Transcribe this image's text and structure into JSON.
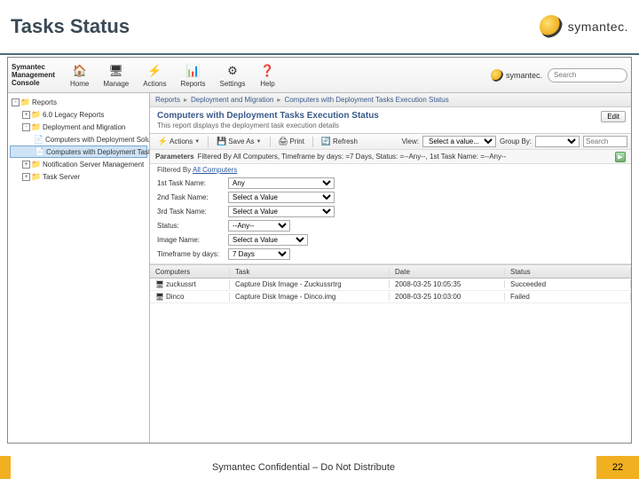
{
  "slide": {
    "title": "Tasks Status",
    "footer": "Symantec Confidential – Do Not Distribute",
    "page": "22"
  },
  "brand": {
    "name": "symantec.",
    "console_label": "Symantec\nManagement\nConsole"
  },
  "topnav": [
    {
      "label": "Home",
      "icon": "🏠"
    },
    {
      "label": "Manage",
      "icon": "🖥"
    },
    {
      "label": "Actions",
      "icon": "⚡"
    },
    {
      "label": "Reports",
      "icon": "📊"
    },
    {
      "label": "Settings",
      "icon": "⚙"
    },
    {
      "label": "Help",
      "icon": "❓"
    }
  ],
  "search": {
    "placeholder": "Search"
  },
  "tree": [
    {
      "toggle": "-",
      "icon": "📁",
      "label": "Reports",
      "indent": 0
    },
    {
      "toggle": "+",
      "icon": "📁",
      "label": "6.0 Legacy Reports",
      "indent": 1
    },
    {
      "toggle": "-",
      "icon": "📁",
      "label": "Deployment and Migration",
      "indent": 1
    },
    {
      "toggle": "",
      "icon": "📄",
      "label": "Computers with Deployment Solution T",
      "indent": 2
    },
    {
      "toggle": "",
      "icon": "📄",
      "label": "Computers with Deployment Tasks Exe",
      "indent": 2,
      "selected": true
    },
    {
      "toggle": "+",
      "icon": "📁",
      "label": "Notification Server Management",
      "indent": 1
    },
    {
      "toggle": "+",
      "icon": "📁",
      "label": "Task Server",
      "indent": 1
    }
  ],
  "breadcrumb": [
    "Reports",
    "Deployment and Migration",
    "Computers with Deployment Tasks Execution Status"
  ],
  "report": {
    "title": "Computers with Deployment Tasks Execution Status",
    "subtitle": "This report displays the deployment task execution details",
    "edit": "Edit"
  },
  "toolbar": {
    "actions": "Actions",
    "saveas": "Save As",
    "print": "Print",
    "refresh": "Refresh",
    "view_label": "View:",
    "view_value": "Select a value...",
    "group_label": "Group By:",
    "search": "Search"
  },
  "parameters": {
    "label": "Parameters",
    "summary": "Filtered By All Computers, Timeframe by days: =7 Days, Status: =--Any--, 1st Task Name: =--Any--",
    "filtered_prefix": "Filtered By",
    "filtered_link": "All Computers",
    "rows": [
      {
        "label": "1st Task Name:",
        "value": "Any"
      },
      {
        "label": "2nd Task Name:",
        "value": "Select a Value"
      },
      {
        "label": "3rd Task Name:",
        "value": "Select a Value"
      },
      {
        "label": "Status:",
        "value": "--Any--"
      },
      {
        "label": "Image Name:",
        "value": "Select a Value"
      },
      {
        "label": "Timeframe by days:",
        "value": "7 Days"
      }
    ]
  },
  "table": {
    "headers": [
      "Computers",
      "Task",
      "Date",
      "Status"
    ],
    "rows": [
      {
        "c": "zuckussrt",
        "t": "Capture Disk Image - Zuckussrtrg",
        "d": "2008-03-25 10:05:35",
        "s": "Succeeded"
      },
      {
        "c": "Dinco",
        "t": "Capture Disk Image - Dinco.img",
        "d": "2008-03-25 10:03:00",
        "s": "Failed"
      }
    ]
  }
}
